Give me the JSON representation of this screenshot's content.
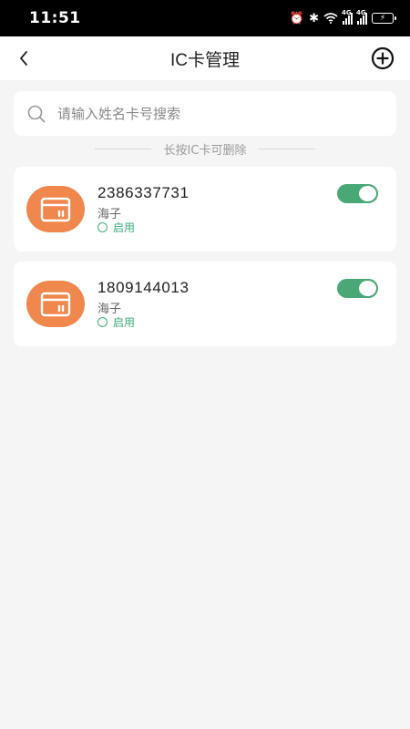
{
  "status_bar": {
    "time": "11:51",
    "network_label": "4G"
  },
  "nav": {
    "title": "IC卡管理"
  },
  "search": {
    "placeholder": "请输入姓名卡号搜索",
    "value": ""
  },
  "hint": "长按IC卡可删除",
  "cards": [
    {
      "number": "2386337731",
      "owner": "海子",
      "status": "启用",
      "enabled": true
    },
    {
      "number": "1809144013",
      "owner": "海子",
      "status": "启用",
      "enabled": true
    }
  ],
  "colors": {
    "accent_green": "#4aa877",
    "avatar_orange": "#f0874d",
    "status_green": "#3fa97a"
  }
}
